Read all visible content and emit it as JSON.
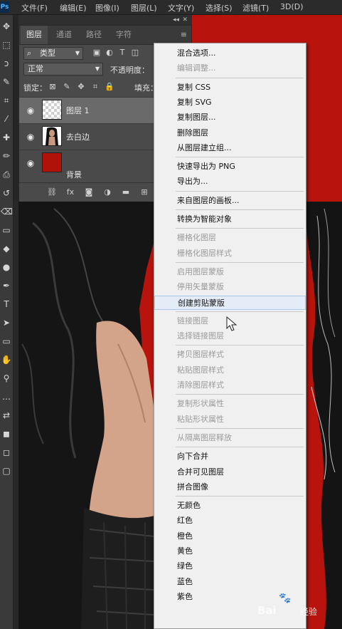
{
  "app": {
    "logo": "Ps"
  },
  "menubar": [
    "文件(F)",
    "编辑(E)",
    "图像(I)",
    "图层(L)",
    "文字(Y)",
    "选择(S)",
    "滤镜(T)",
    "3D(D)"
  ],
  "toolbar": {
    "tools": [
      "move-tool",
      "marquee-tool",
      "lasso-tool",
      "quick-select-tool",
      "crop-tool",
      "eyedropper-tool",
      "healing-brush-tool",
      "brush-tool",
      "clone-stamp-tool",
      "history-brush-tool",
      "eraser-tool",
      "gradient-tool",
      "blur-tool",
      "dodge-tool",
      "pen-tool",
      "type-tool",
      "path-select-tool",
      "shape-tool",
      "hand-tool",
      "zoom-tool",
      "more-tools",
      "swap-colors",
      "default-colors",
      "quick-mask",
      "screen-mode"
    ]
  },
  "panel": {
    "collapse_glyph": "◂◂",
    "close_glyph": "✕",
    "tabs": [
      "图层",
      "通道",
      "路径",
      "字符"
    ],
    "active_tab": 0,
    "menu_glyph": "≡",
    "kind_filter": {
      "icon": "⌕",
      "value": "类型"
    },
    "blend_mode": "正常",
    "opacity_label": "不透明度：",
    "lock_label": "锁定：",
    "fill_label": "填充：",
    "layers": [
      {
        "name": "图层 1",
        "thumb": "transparent",
        "selected": true
      },
      {
        "name": "去白边",
        "thumb": "portrait",
        "selected": false
      },
      {
        "name": "背景",
        "thumb": "red",
        "selected": false
      }
    ],
    "bottom_icons": [
      "link-icon",
      "fx-icon",
      "mask-icon",
      "adjustment-icon",
      "folder-icon",
      "new-layer-icon",
      "trash-icon"
    ]
  },
  "context_menu": {
    "groups": [
      [
        {
          "label": "混合选项...",
          "enabled": true
        },
        {
          "label": "编辑调整...",
          "enabled": false
        }
      ],
      [
        {
          "label": "复制 CSS",
          "enabled": true
        },
        {
          "label": "复制 SVG",
          "enabled": true
        },
        {
          "label": "复制图层...",
          "enabled": true
        },
        {
          "label": "删除图层",
          "enabled": true
        },
        {
          "label": "从图层建立组...",
          "enabled": true
        }
      ],
      [
        {
          "label": "快速导出为 PNG",
          "enabled": true
        },
        {
          "label": "导出为...",
          "enabled": true
        }
      ],
      [
        {
          "label": "来自图层的画板...",
          "enabled": true
        }
      ],
      [
        {
          "label": "转换为智能对象",
          "enabled": true
        }
      ],
      [
        {
          "label": "栅格化图层",
          "enabled": false
        },
        {
          "label": "栅格化图层样式",
          "enabled": false
        }
      ],
      [
        {
          "label": "启用图层蒙版",
          "enabled": false
        },
        {
          "label": "停用矢量蒙版",
          "enabled": false
        },
        {
          "label": "创建剪贴蒙版",
          "enabled": true,
          "hovered": true
        }
      ],
      [
        {
          "label": "链接图层",
          "enabled": false
        },
        {
          "label": "选择链接图层",
          "enabled": false
        }
      ],
      [
        {
          "label": "拷贝图层样式",
          "enabled": false
        },
        {
          "label": "粘贴图层样式",
          "enabled": false
        },
        {
          "label": "清除图层样式",
          "enabled": false
        }
      ],
      [
        {
          "label": "复制形状属性",
          "enabled": false
        },
        {
          "label": "粘贴形状属性",
          "enabled": false
        }
      ],
      [
        {
          "label": "从隔离图层释放",
          "enabled": false
        }
      ],
      [
        {
          "label": "向下合并",
          "enabled": true
        },
        {
          "label": "合并可见图层",
          "enabled": true
        },
        {
          "label": "拼合图像",
          "enabled": true
        }
      ],
      [
        {
          "label": "无颜色",
          "enabled": true
        },
        {
          "label": "红色",
          "enabled": true
        },
        {
          "label": "橙色",
          "enabled": true
        },
        {
          "label": "黄色",
          "enabled": true
        },
        {
          "label": "绿色",
          "enabled": true
        },
        {
          "label": "蓝色",
          "enabled": true
        },
        {
          "label": "紫色",
          "enabled": true
        }
      ]
    ]
  },
  "watermark": {
    "brand": "Bai",
    "mid": "经验",
    "paw": "🐾"
  },
  "colors": {
    "canvas_red": "#b8140d",
    "menu_bg": "#f0f0f0",
    "hover": "#e3ecf7"
  }
}
